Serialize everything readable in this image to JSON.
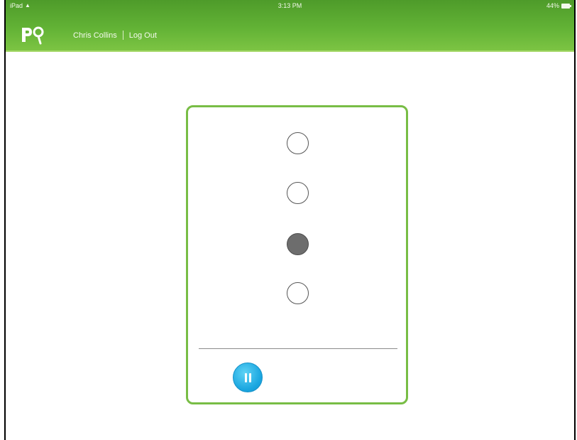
{
  "status_bar": {
    "device": "iPad",
    "wifi_icon": "wifi-icon",
    "time": "3:13 PM",
    "battery_text": "44%",
    "battery_icon": "battery-icon"
  },
  "header": {
    "logo_text": "Pq",
    "user_name": "Chris Collins",
    "logout_label": "Log Out",
    "colors": {
      "header_green": "#62b235",
      "accent_green": "#78bd45"
    }
  },
  "card": {
    "options": [
      {
        "selected": false
      },
      {
        "selected": false
      },
      {
        "selected": true
      },
      {
        "selected": false
      }
    ],
    "pause_icon": "pause-icon",
    "pause_color": "#1aa6e0"
  }
}
